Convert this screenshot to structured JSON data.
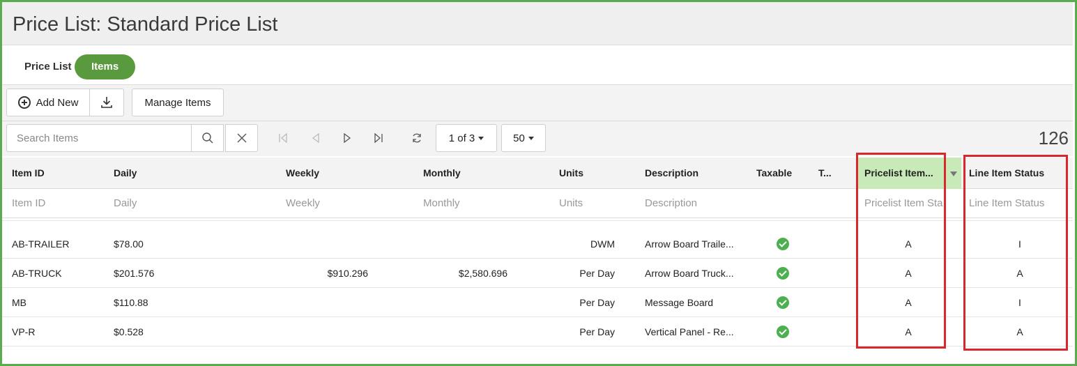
{
  "page": {
    "title": "Price List: Standard Price List"
  },
  "tabs": [
    {
      "label": "Price List",
      "active": false
    },
    {
      "label": "Items",
      "active": true
    }
  ],
  "toolbar": {
    "add_new_label": "Add New",
    "download_icon": "download-icon",
    "manage_items_label": "Manage Items"
  },
  "search": {
    "placeholder": "Search Items",
    "page_label": "1 of 3",
    "page_size": "50",
    "total": "126"
  },
  "table": {
    "headers": {
      "item_id": "Item ID",
      "daily": "Daily",
      "weekly": "Weekly",
      "monthly": "Monthly",
      "units": "Units",
      "description": "Description",
      "taxable": "Taxable",
      "t": "T...",
      "pricelist_item": "Pricelist Item...",
      "line_item_status": "Line Item Status"
    },
    "filters": {
      "item_id": "Item ID",
      "daily": "Daily",
      "weekly": "Weekly",
      "monthly": "Monthly",
      "units": "Units",
      "description": "Description",
      "pricelist_item": "Pricelist Item Sta",
      "line_item_status": "Line Item Status"
    },
    "rows": [
      {
        "item_id": "AB-TRAILER",
        "daily": "$78.00",
        "weekly": "",
        "monthly": "",
        "units": "DWM",
        "description": "Arrow Board Traile...",
        "taxable": true,
        "pricelist_item": "A",
        "line_item_status": "I"
      },
      {
        "item_id": "AB-TRUCK",
        "daily": "$201.576",
        "weekly": "$910.296",
        "monthly": "$2,580.696",
        "units": "Per Day",
        "description": "Arrow Board Truck...",
        "taxable": true,
        "pricelist_item": "A",
        "line_item_status": "A"
      },
      {
        "item_id": "MB",
        "daily": "$110.88",
        "weekly": "",
        "monthly": "",
        "units": "Per Day",
        "description": "Message Board",
        "taxable": true,
        "pricelist_item": "A",
        "line_item_status": "I"
      },
      {
        "item_id": "VP-R",
        "daily": "$0.528",
        "weekly": "",
        "monthly": "",
        "units": "Per Day",
        "description": "Vertical Panel - Re...",
        "taxable": true,
        "pricelist_item": "A",
        "line_item_status": "A"
      }
    ]
  },
  "colors": {
    "frame": "#5aad4e",
    "active_tab": "#5a9a3e",
    "sorted_header": "#c7eab8",
    "highlight": "#d9272e",
    "check": "#4caf50"
  }
}
